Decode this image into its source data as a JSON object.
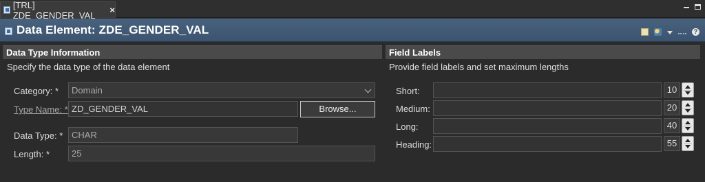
{
  "tab": {
    "label": "[TRL] ZDE_GENDER_VAL",
    "close": "×"
  },
  "header": {
    "title": "Data Element: ZDE_GENDER_VAL",
    "help": "?"
  },
  "data_type_section": {
    "title": "Data Type Information",
    "description": "Specify the data type of the data element",
    "category": {
      "label": "Category: *",
      "value": "Domain"
    },
    "type_name": {
      "label": "Type Name: *",
      "value": "ZD_GENDER_VAL",
      "browse": "Browse..."
    },
    "data_type": {
      "label": "Data Type: *",
      "value": "CHAR"
    },
    "length": {
      "label": "Length: *",
      "value": "25"
    }
  },
  "field_labels_section": {
    "title": "Field Labels",
    "description": "Provide field labels and set maximum lengths",
    "rows": [
      {
        "label": "Short:",
        "text": "",
        "max": "10"
      },
      {
        "label": "Medium:",
        "text": "",
        "max": "20"
      },
      {
        "label": "Long:",
        "text": "",
        "max": "40"
      },
      {
        "label": "Heading:",
        "text": "",
        "max": "55"
      }
    ]
  }
}
